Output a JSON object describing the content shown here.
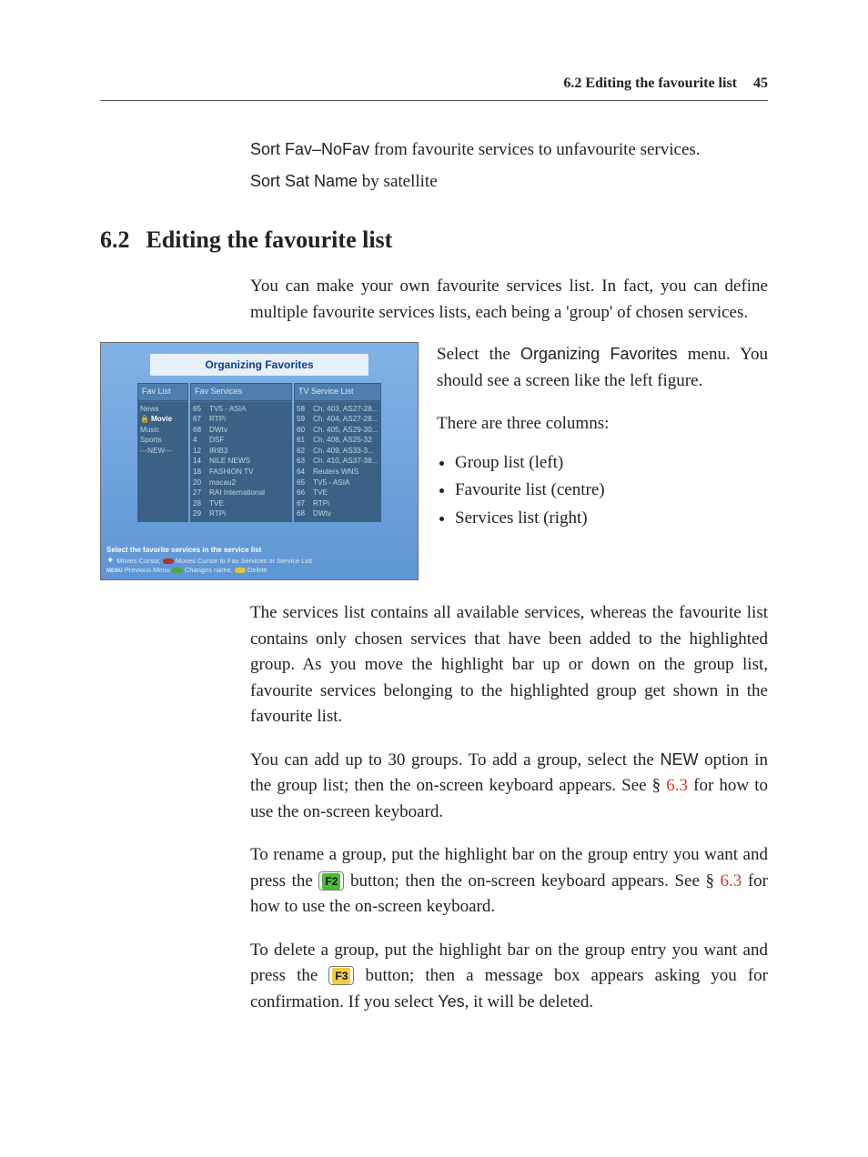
{
  "header": {
    "section": "6.2 Editing the favourite list",
    "page_number": "45"
  },
  "defs": [
    {
      "term": "Sort Fav–NoFav",
      "desc": " from favourite services to unfavourite services."
    },
    {
      "term": "Sort Sat Name",
      "desc": " by satellite"
    }
  ],
  "section": {
    "num": "6.2",
    "title": "Editing the favourite list"
  },
  "intro": "You can make your own favourite services list. In fact, you can define multiple favourite services lists, each being a 'group' of chosen services.",
  "side": {
    "p1a": "Select the ",
    "p1b": "Organizing Favorites",
    "p1c": " menu. You should see a screen like the left figure.",
    "p2": "There are three columns:",
    "bullets": [
      "Group list (left)",
      "Favourite list (centre)",
      "Services list (right)"
    ]
  },
  "screenshot": {
    "title": "Organizing Favorites",
    "col1_head": "Fav List",
    "col2_head": "Fav Services",
    "col3_head": "TV Service List",
    "groups": [
      "News",
      "Movie",
      "Music",
      "Sports",
      "---NEW---"
    ],
    "fav_services": [
      {
        "n": "65",
        "name": "TV5 - ASIA"
      },
      {
        "n": "67",
        "name": "RTPi"
      },
      {
        "n": "68",
        "name": "DWtv"
      },
      {
        "n": "4",
        "name": "DSF"
      },
      {
        "n": "12",
        "name": "IRIB3"
      },
      {
        "n": "14",
        "name": "NILE NEWS"
      },
      {
        "n": "18",
        "name": "FASHION TV"
      },
      {
        "n": "20",
        "name": "macau2"
      },
      {
        "n": "27",
        "name": "RAI International"
      },
      {
        "n": "28",
        "name": "TVE"
      },
      {
        "n": "29",
        "name": "RTPi"
      }
    ],
    "services": [
      {
        "n": "58",
        "name": "Ch. 403, AS27-28..."
      },
      {
        "n": "59",
        "name": "Ch. 404, AS27-28..."
      },
      {
        "n": "60",
        "name": "Ch. 405, AS29-30..."
      },
      {
        "n": "61",
        "name": "Ch. 408, AS25-32"
      },
      {
        "n": "62",
        "name": "Ch. 409, AS33-3..."
      },
      {
        "n": "63",
        "name": "Ch. 410, AS37-38..."
      },
      {
        "n": "64",
        "name": "Reuters WNS"
      },
      {
        "n": "65",
        "name": "TV5 - ASIA"
      },
      {
        "n": "66",
        "name": "TVE"
      },
      {
        "n": "67",
        "name": "RTPi"
      },
      {
        "n": "68",
        "name": "DWtv"
      }
    ],
    "footer1": "Select the favorite services in the service list",
    "footer2a": "Moves Cursor, ",
    "footer2b": "Moves Cursor to Fav Services or Service List",
    "footer3a": "Previous Menu ",
    "footer3b": "Changes name, ",
    "footer3c": "Delete",
    "menu_label": "MENU"
  },
  "body": {
    "p1": "The services list contains all available services, whereas the favourite list contains only chosen services that have been added to the highlighted group. As you move the highlight bar up or down on the group list, favourite services belonging to the highlighted group get shown in the favourite list.",
    "p2a": "You can add up to 30 groups. To add a group, select the ",
    "p2b": "NEW",
    "p2c": " option in the group list; then the on-screen keyboard appears. See § ",
    "p2link": "6.3",
    "p2d": " for how to use the on-screen keyboard.",
    "p3a": "To rename a group, put the highlight bar on the group entry you want and press the ",
    "p3key": "F2",
    "p3b": " button; then the on-screen keyboard appears. See § ",
    "p3link": "6.3",
    "p3c": " for how to use the on-screen keyboard.",
    "p4a": "To delete a group, put the highlight bar on the group entry you want and press the ",
    "p4key": "F3",
    "p4b": " button; then a message box appears asking you for confirmation. If you select ",
    "p4yes": "Yes",
    "p4c": ", it will be deleted."
  }
}
